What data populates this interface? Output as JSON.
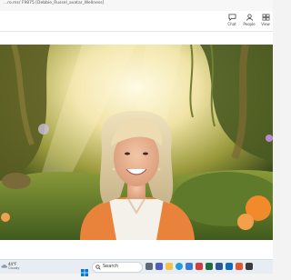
{
  "window": {
    "title": "...ro.ms/ F9875 [Debbie_Russel_avatar_Wellness]"
  },
  "toolbar": {
    "items": [
      {
        "label": "Chat",
        "icon": "chat-icon"
      },
      {
        "label": "People",
        "icon": "people-icon"
      },
      {
        "label": "View",
        "icon": "view-grid-icon"
      }
    ]
  },
  "video": {
    "background": "enchanted-forest-virtual-background",
    "participant": "presenter-woman-blonde-orange-cardigan"
  },
  "taskbar": {
    "weather": {
      "temp": "44°F",
      "condition": "Cloudy"
    },
    "search_placeholder": "Search",
    "apps": [
      "start-icon",
      "search-icon",
      "task-view-icon",
      "teams-icon",
      "explorer-icon",
      "edge-icon",
      "store-icon",
      "mail-icon",
      "excel-icon",
      "word-icon",
      "outlook-icon",
      "calendar-icon",
      "camera-icon"
    ]
  },
  "colors": {
    "accent": "#0078d4",
    "taskbar": "#e8edf3",
    "cardigan": "#e9823b"
  }
}
